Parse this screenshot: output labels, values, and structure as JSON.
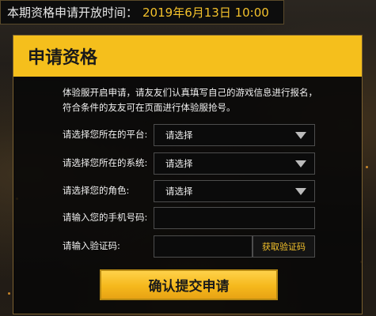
{
  "banner": {
    "label": "本期资格申请开放时间：",
    "value": "2019年6月13日 10:00"
  },
  "panel": {
    "title": "申请资格",
    "description": [
      "体验服开启申请，请友友们认真填写自己的游戏信息进行报名，",
      "符合条件的友友可在页面进行体验服抢号。"
    ],
    "fields": {
      "platform": {
        "label": "请选择您所在的平台:",
        "value": "请选择"
      },
      "system": {
        "label": "请选择您所在的系统:",
        "value": "请选择"
      },
      "role": {
        "label": "请选择您的角色:",
        "value": "请选择"
      },
      "phone": {
        "label": "请输入您的手机号码:",
        "value": ""
      },
      "code": {
        "label": "请输入验证码:",
        "value": "",
        "button": "获取验证码"
      }
    },
    "submit_label": "确认提交申请"
  },
  "colors": {
    "accent": "#f5bf1c",
    "panel_bg": "#080808",
    "text": "#f0f0f0"
  }
}
